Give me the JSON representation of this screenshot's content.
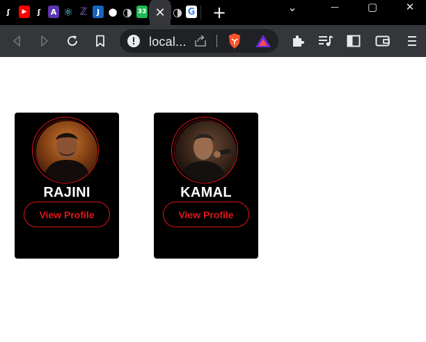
{
  "browser": {
    "tabs": [
      {
        "icon": "squiggle-icon",
        "glyph": "ʃ",
        "color": "#f4b400"
      },
      {
        "icon": "youtube-icon",
        "glyph": "▶",
        "color": "#ff0000"
      },
      {
        "icon": "squiggle-icon",
        "glyph": "ʃ",
        "color": "#f4b400"
      },
      {
        "icon": "rocket-icon",
        "glyph": "A",
        "color": "#7e57c2"
      },
      {
        "icon": "react-icon",
        "glyph": "⚛",
        "color": "#61dafb"
      },
      {
        "icon": "redux-icon",
        "glyph": "ℤ",
        "color": "#8a63d2"
      },
      {
        "icon": "jb-icon",
        "glyph": "J",
        "color": "#1e88e5"
      },
      {
        "icon": "github-icon",
        "glyph": "●",
        "color": "#ffffff"
      },
      {
        "icon": "generic-site-icon",
        "glyph": "◑",
        "color": "#cfcfcf"
      },
      {
        "icon": "counter-icon",
        "glyph": "33",
        "color": "#2ecc71"
      },
      {
        "icon": "generic-site-icon",
        "glyph": "◑",
        "color": "#cfcfcf"
      },
      {
        "icon": "google-icon",
        "glyph": "G",
        "color": "#4285f4"
      }
    ],
    "active_tab_close": "✕",
    "new_tab": "+",
    "window_controls": {
      "minimize": "—",
      "maximize": "▢",
      "close": "✕",
      "tab_search": "⌄"
    },
    "url": "local...",
    "accent_color": "#e0151b"
  },
  "profiles": [
    {
      "name": "RAJINI",
      "button_label": "View Profile"
    },
    {
      "name": "KAMAL",
      "button_label": "View Profile"
    }
  ]
}
